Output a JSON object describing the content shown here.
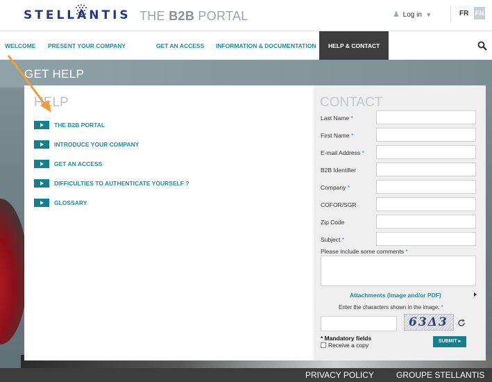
{
  "header": {
    "logo_text": "STELLANTIS",
    "portal_prefix": "THE ",
    "portal_bold": "B2B",
    "portal_suffix": " PORTAL",
    "login_label": "Log in",
    "lang_fr": "FR",
    "lang_en": "EN"
  },
  "nav": {
    "items": [
      {
        "label": "WELCOME"
      },
      {
        "label": "PRESENT YOUR COMPANY"
      },
      {
        "label": "GET AN ACCESS"
      },
      {
        "label": "INFORMATION & DOCUMENTATION"
      },
      {
        "label": "HELP & CONTACT",
        "active": true
      }
    ]
  },
  "page": {
    "title": "GET HELP"
  },
  "help": {
    "title": "HELP",
    "items": [
      {
        "label": "THE B2B PORTAL"
      },
      {
        "label": "INTRODUCE YOUR COMPANY"
      },
      {
        "label": "GET AN ACCESS"
      },
      {
        "label": "DIFFICULTIES TO AUTHENTICATE YOURSELF ?"
      },
      {
        "label": "GLOSSARY"
      }
    ]
  },
  "contact": {
    "title": "CONTACT",
    "fields": [
      {
        "label": "Last Name",
        "required": "*"
      },
      {
        "label": "First Name",
        "required": "*"
      },
      {
        "label": "E-mail Address",
        "required": "*"
      },
      {
        "label": "B2B Identifier",
        "required": ""
      },
      {
        "label": "Company",
        "required": "*"
      },
      {
        "label": "COFOR/SGR",
        "required": ""
      },
      {
        "label": "Zip Code",
        "required": ""
      },
      {
        "label": "Subject",
        "required": "*"
      }
    ],
    "comments_label": "Please include some comments",
    "comments_required": "*",
    "attachments_label": "Attachments (image and/or PDF)",
    "captcha_hint": "Enter the characters shown in the image:",
    "captcha_required": "*",
    "captcha_text": "63Δ3",
    "mandatory_label": "* Mandatory fields",
    "copy_label": "Receive a copy",
    "submit_label": "SUBMIT"
  },
  "footer": {
    "privacy": "PRIVACY POLICY",
    "group": "GROUPE STELLANTIS"
  },
  "colors": {
    "accent": "#1b8d9f",
    "arrow_button": "#13808f",
    "nav_active": "#3c3c3c",
    "annotation": "#f39a3a"
  }
}
